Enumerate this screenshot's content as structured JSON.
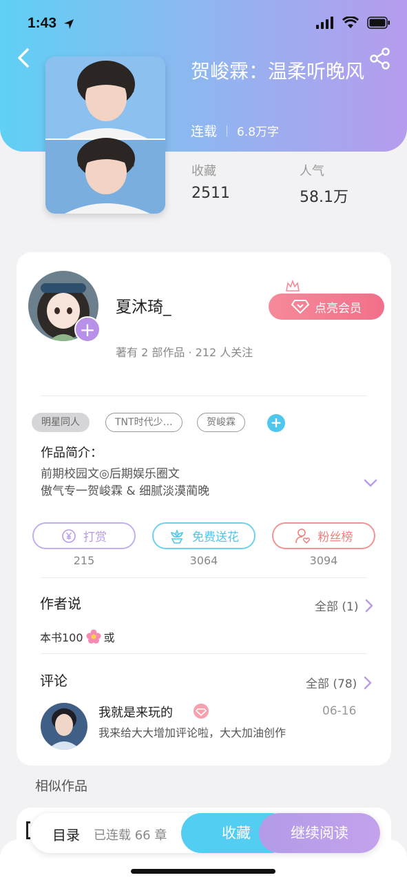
{
  "colors": {
    "header_gradient_start": "#5fd0f4",
    "header_gradient_end": "#b69cee",
    "accent_blue": "#54cdf2",
    "accent_purple": "#b29be8",
    "vip_pink": "#f26f8a"
  },
  "status_bar": {
    "time": "1:43",
    "icons": [
      "location-arrow-icon",
      "signal-icon",
      "wifi-icon",
      "battery-icon"
    ]
  },
  "header": {
    "back_icon": "chevron-left-icon",
    "share_icon": "share-icon"
  },
  "book": {
    "title": "贺峻霖：温柔听晚风",
    "status": "连载",
    "word_count": "6.8万字",
    "stats": [
      {
        "label": "收藏",
        "value": "2511"
      },
      {
        "label": "人气",
        "value": "58.1万"
      }
    ]
  },
  "author": {
    "name": "夏沐琦_",
    "summary": "著有 2 部作品 · 212 人关注",
    "vip_button": "点亮会员"
  },
  "tags": [
    "明星同人",
    "TNT时代少…",
    "贺峻霖"
  ],
  "intro": {
    "label": "作品简介：",
    "lines": [
      "前期校园文◎后期娱乐圈文",
      "傲气专一贺峻霖 & 细腻淡漠蔺晚"
    ]
  },
  "actions": [
    {
      "label": "打赏",
      "count": "215",
      "color": "#b89be9",
      "icon": "yen-coin-icon"
    },
    {
      "label": "免费送花",
      "count": "3064",
      "color": "#4ec6ee",
      "icon": "flower-icon"
    },
    {
      "label": "粉丝榜",
      "count": "3094",
      "color": "#f07e7e",
      "icon": "fan-user-icon"
    }
  ],
  "author_say": {
    "title": "作者说",
    "more": "全部 (1)",
    "text_before": "本书100",
    "text_after": "或"
  },
  "comments": {
    "title": "评论",
    "more": "全部 (78)",
    "items": [
      {
        "user": "我就是来玩的",
        "date": "06-16",
        "text": "我来给大大增加评论啦，大大加油创作"
      }
    ]
  },
  "similar": {
    "title": "相似作品"
  },
  "bottom_bar": {
    "toc": "目录",
    "chapters": "已连载 66 章",
    "collect": "收藏",
    "continue_read": "继续阅读"
  }
}
